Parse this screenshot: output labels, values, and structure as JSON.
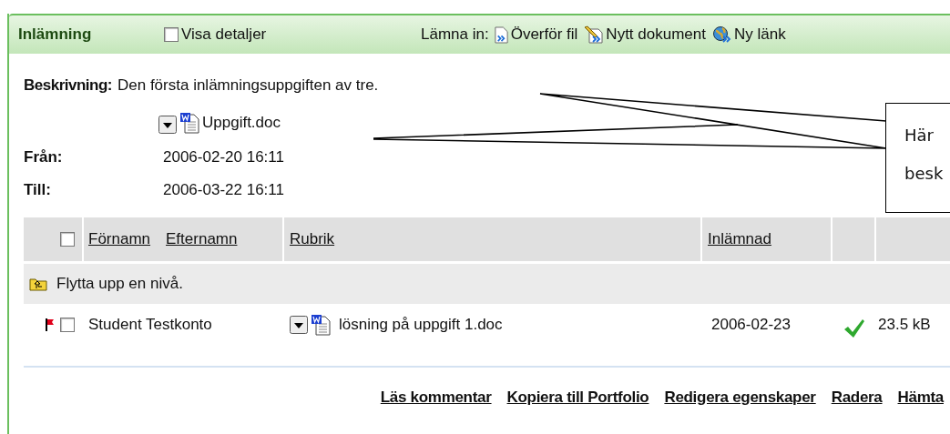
{
  "header": {
    "title": "Inlämning",
    "show_details": {
      "label": "Visa detaljer",
      "checked": false
    },
    "submit_label": "Lämna in:",
    "submit_actions": [
      {
        "kind": "upload",
        "label": "Överför fil"
      },
      {
        "kind": "document",
        "label": "Nytt dokument"
      },
      {
        "kind": "link",
        "label": "Ny länk"
      }
    ]
  },
  "description": {
    "label": "Beskrivning:",
    "text": "Den första inlämningsuppgiften av tre.",
    "attachment": "Uppgift.doc"
  },
  "dates": [
    {
      "label": "Från:",
      "value": "2006-02-20 16:11"
    },
    {
      "label": "Till:",
      "value": "2006-03-22 16:11"
    }
  ],
  "table": {
    "select_all": {
      "checked": false
    },
    "columns": [
      "Förnamn",
      "Efternamn",
      "Rubrik",
      "Inlämnad"
    ],
    "rows": [
      {
        "kind": "folder",
        "label": "Flytta upp en nivå."
      },
      {
        "kind": "submission",
        "flagged": true,
        "checked": false,
        "name": "Student Testkonto",
        "title": "lösning på uppgift 1.doc",
        "submitted": "2006-02-23",
        "approved": true,
        "size": "23.5 kB"
      }
    ]
  },
  "actions": [
    "Läs kommentar",
    "Kopiera till Portfolio",
    "Redigera egenskaper",
    "Radera",
    "Hämta"
  ],
  "callout": {
    "lines": [
      "Här",
      "besk"
    ]
  }
}
